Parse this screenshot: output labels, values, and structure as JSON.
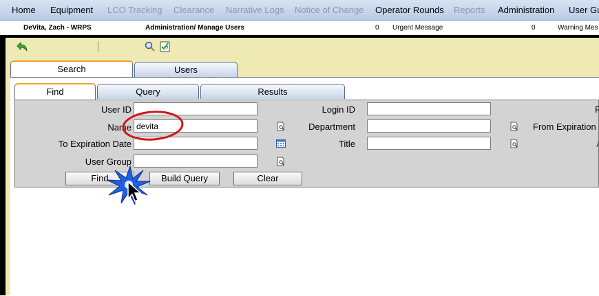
{
  "menu": {
    "items": [
      {
        "label": "Home",
        "enabled": true
      },
      {
        "label": "Equipment",
        "enabled": true
      },
      {
        "label": "LCO Tracking",
        "enabled": false
      },
      {
        "label": "Clearance",
        "enabled": false
      },
      {
        "label": "Narrative Logs",
        "enabled": false
      },
      {
        "label": "Notice of Change",
        "enabled": false
      },
      {
        "label": "Operator Rounds",
        "enabled": true
      },
      {
        "label": "Reports",
        "enabled": false
      },
      {
        "label": "Administration",
        "enabled": true
      },
      {
        "label": "User Gui",
        "enabled": true
      }
    ]
  },
  "info_bar": {
    "user": "DeVita, Zach - WRPS",
    "breadcrumb": "Administration/ Manage Users",
    "urgent_count": "0",
    "urgent_label": "Urgent Message",
    "warning_count": "0",
    "warning_label": "Warning Mes"
  },
  "toolbar": {
    "icons": [
      "back-arrow-icon",
      "search-magnifier-icon",
      "help-checklist-icon"
    ]
  },
  "tabs_top": {
    "search": "Search",
    "users": "Users"
  },
  "tabs_sub": {
    "find": "Find",
    "query": "Query",
    "results": "Results"
  },
  "form": {
    "user_id_label": "User ID",
    "user_id_value": "",
    "name_label": "Name",
    "name_value": "devita",
    "to_exp_label": "To Expiration Date",
    "to_exp_value": "",
    "user_group_label": "User Group",
    "user_group_value": "",
    "login_id_label": "Login ID",
    "login_id_value": "",
    "department_label": "Department",
    "department_value": "",
    "title_label": "Title",
    "title_value": "",
    "right_label_1": "F",
    "right_label_2": "From Expiration",
    "right_label_3": "A"
  },
  "buttons": {
    "find": "Find",
    "build_query": "Build Query",
    "clear": "Clear"
  },
  "colors": {
    "menu_bg": "#c8d7ec",
    "content_bg": "#efe9b5",
    "panel_bg": "#d3d3d3",
    "active_tab_accent": "#f0a128",
    "annotation_red": "#d01818",
    "annotation_burst": "#1e5fe6"
  }
}
